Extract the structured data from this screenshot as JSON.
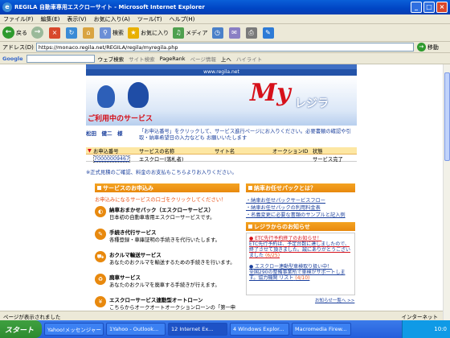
{
  "window": {
    "title": "REGILA  自動車専用エスクローサイト - Microsoft Internet Explorer",
    "min_symbol": "_",
    "max_symbol": "□",
    "close_symbol": "×",
    "ie_logo_glyph": "e"
  },
  "menu": [
    "ファイル(F)",
    "編集(E)",
    "表示(V)",
    "お気に入り(A)",
    "ツール(T)",
    "ヘルプ(H)"
  ],
  "toolbar": {
    "back_label": "戻る",
    "search_label": "検索",
    "favorites_label": "お気に入り",
    "media_label": "メディア",
    "glyphs": {
      "back": "←",
      "forward": "→",
      "stop": "×",
      "refresh": "↻",
      "home": "⌂",
      "search": "⚲",
      "favorites": "★",
      "media": "♫",
      "history": "◷",
      "mail": "✉",
      "print": "⎙",
      "edit": "✎"
    }
  },
  "address": {
    "label": "アドレス(D)",
    "url": "https://monaco.regila.net/REGILA/regila/myregila.php",
    "go_label": "移動"
  },
  "google": {
    "logo": "Google",
    "buttons": [
      "ウェブ検索",
      "サイト検索",
      "PageRank",
      "ページ情報",
      "上へ",
      "ハイライト"
    ]
  },
  "page": {
    "site_url": "www.regila.net",
    "brand_my": "My",
    "brand_regi": "レジラ",
    "service_heading": "ご利用中のサービス",
    "user_name": "松田　健二　様",
    "instructions": "「お申込番号」をクリックして、サービス進行ページにお入りください。必要書類の確認や引取・納車希望日の入力なども お願いいたします",
    "table": {
      "headers": [
        "お申込番号",
        "サービスの名称",
        "サイト名",
        "オークションID",
        "状態"
      ],
      "rows": [
        [
          "70000009467",
          "エスクロー(落札者)",
          "",
          "",
          "サービス完了"
        ]
      ]
    },
    "note": "※正式見積のご確認、料金のお支払もこちらよりお入りください。",
    "left_section": {
      "title": "サービスのお申込み",
      "red_note": "お申込みになるサービスの口ゴをクリックしてください！",
      "items": [
        {
          "icon": "◐",
          "title": "納車おまかせパック（エスクローサービス）",
          "desc": "日本初の自動車専用エスクローサービスです。"
        },
        {
          "icon": "✎",
          "title": "手続き代行サービス",
          "desc": "各種登録・車庫証明の手続きを代行いたします。"
        },
        {
          "icon": "⛟",
          "title": "おクルマ輸送サービス",
          "desc": "あなたのおクルマを輸送するための手続きを行います。"
        },
        {
          "icon": "♻",
          "title": "廃車サービス",
          "desc": "あなたのおクルマを廃車する手続きが行えます。"
        },
        {
          "icon": "¥",
          "title": "エスクローサービス連動型オートローン",
          "desc": "こちらからオークオートオークションローンの「第一申"
        }
      ]
    },
    "right_section": {
      "title1": "納車お任せパックとは？",
      "links": [
        "・納車お任せパックサービスフロー",
        "・納車お任せパックの利用料金表",
        "・名義変更に必要な書類のサンプルと記入例"
      ],
      "title2": "レジラからのお知らせ",
      "news": [
        {
          "text": "● ETC先行予約終了のお知らせ！",
          "text2": "ETC先行予約は、予定台数に達しましたので、終了させて頂きました。誠にありがとうございました",
          "date": "(6/25)"
        },
        {
          "text": "● エスクロー連動型車検取り扱い中！",
          "text2": "全国290の整備事業所で車検がサポートします。協力機関 リスト",
          "date": "(4/10)"
        }
      ],
      "more": "お知らせ一覧へ >>"
    }
  },
  "status": {
    "text": "ページが表示されました",
    "zone": "インターネット"
  },
  "taskbar": {
    "start": "スタート",
    "tasks": [
      "Yahoo!メッセンジャー",
      "1Yahoo - Outlook...",
      "12 Internet Ex...",
      "4 Windows Explor...",
      "Macromedia Firew..."
    ],
    "time": "10:0"
  }
}
